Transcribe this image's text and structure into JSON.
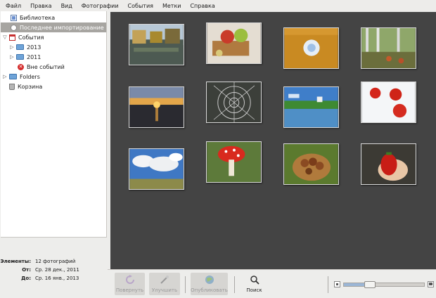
{
  "menu": [
    "Файл",
    "Правка",
    "Вид",
    "Фотографии",
    "События",
    "Метки",
    "Справка"
  ],
  "sidebar": {
    "library": "Библиотека",
    "last_import": "Последнее импортирование",
    "events": "События",
    "year_2013": "2013",
    "year_2011": "2011",
    "no_event": "Вне событий",
    "folders": "Folders",
    "trash": "Корзина"
  },
  "info": {
    "items_label": "Элементы:",
    "items_value": "12 фотографий",
    "from_label": "От:",
    "from_value": "Ср. 28 дек., 2011",
    "to_label": "До:",
    "to_value": "Ср. 16 янв., 2013"
  },
  "photos": [
    "autumn-lake",
    "apples-on-board",
    "forest-canopy",
    "forest-mushrooms",
    "sunset-lake",
    "spider-web",
    "lake-house",
    "red-apples-snow",
    "clouds-field",
    "fly-agaric",
    "mushroom-basket",
    "strawberry-hand"
  ],
  "toolbar": {
    "rotate": "Повернуть",
    "enhance": "Улучшить",
    "publish": "Опубликовать",
    "search": "Поиск"
  },
  "zoom": {
    "level": 0.3
  },
  "icons": {
    "library": "library-icon",
    "import": "import-icon",
    "events": "events-icon",
    "folder": "folder-icon",
    "no_event": "no-event-icon",
    "trash": "trash-icon",
    "rotate": "rotate-icon",
    "enhance": "enhance-icon",
    "publish": "publish-icon",
    "search": "search-icon"
  },
  "colors": {
    "viewer_bg": "#444444",
    "selection": "#a7a5a1"
  }
}
